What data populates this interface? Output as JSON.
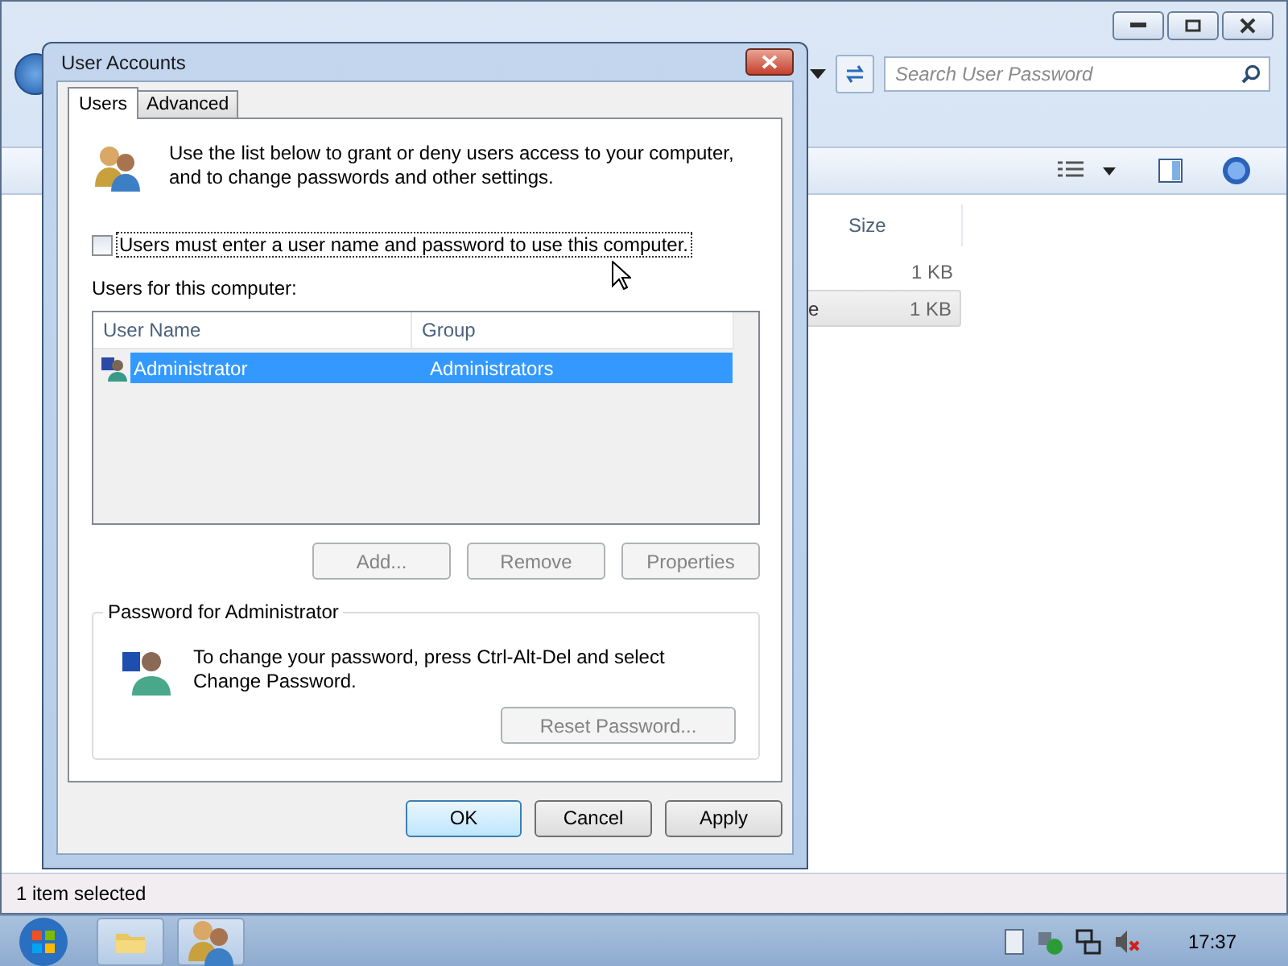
{
  "explorer": {
    "search": {
      "placeholder": "Search User Password"
    },
    "columns": [
      "Size"
    ],
    "rows": [
      {
        "size": "1 KB",
        "selected": false
      },
      {
        "name": "e",
        "size": "1 KB",
        "selected": true
      }
    ],
    "status_bar": "1 item selected"
  },
  "dialog": {
    "title": "User Accounts",
    "tabs": [
      {
        "label": "Users",
        "selected": true
      },
      {
        "label": "Advanced",
        "selected": false
      }
    ],
    "intro": "Use the list below to grant or deny users access to your computer, and to change passwords and other settings.",
    "require_password": {
      "label": "Users must enter a user name and password to use this computer.",
      "checked": false
    },
    "users_label": "Users for this computer:",
    "columns": [
      "User Name",
      "Group"
    ],
    "users": [
      {
        "name": "Administrator",
        "group": "Administrators",
        "selected": true
      }
    ],
    "list_buttons": [
      {
        "label": "Add...",
        "disabled": true
      },
      {
        "label": "Remove",
        "disabled": true
      },
      {
        "label": "Properties",
        "disabled": true
      }
    ],
    "password_group": {
      "title": "Password for Administrator",
      "text": "To change your password, press Ctrl-Alt-Del and select Change Password.",
      "button": {
        "label": "Reset Password...",
        "disabled": true
      }
    },
    "buttons": [
      {
        "label": "OK",
        "default": true,
        "disabled": false
      },
      {
        "label": "Cancel",
        "default": false,
        "disabled": false
      },
      {
        "label": "Apply",
        "default": false,
        "disabled": false
      }
    ]
  },
  "taskbar": {
    "clock": "17:37"
  }
}
